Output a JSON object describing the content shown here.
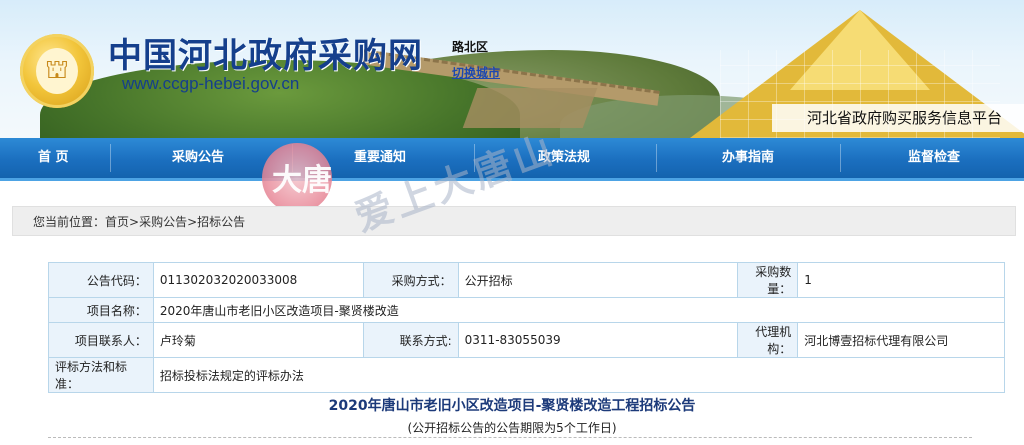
{
  "header": {
    "site_name": "中国河北政府采购网",
    "site_url": "www.ccgp-hebei.gov.cn",
    "region": "路北区",
    "switch_city": "切换城市",
    "platform": "河北省政府购买服务信息平台"
  },
  "nav": {
    "items": [
      {
        "label": "首 页"
      },
      {
        "label": "采购公告"
      },
      {
        "label": "重要通知"
      },
      {
        "label": "政策法规"
      },
      {
        "label": "办事指南"
      },
      {
        "label": "监督检查"
      }
    ]
  },
  "watermark": {
    "badge": "大唐",
    "text": "爱上大唐山"
  },
  "breadcrumb": {
    "prefix": "您当前位置：",
    "home": "首页",
    "sep1": ">",
    "level1": "采购公告",
    "sep2": ">",
    "level2": "招标公告"
  },
  "info": {
    "code_label": "公告代码：",
    "code_value": "011302032020033008",
    "method_label": "采购方式：",
    "method_value": "公开招标",
    "qty_label": "采购数量：",
    "qty_value": "1",
    "project_label": "项目名称：",
    "project_value": "2020年唐山市老旧小区改造项目-聚贤楼改造",
    "contact_label": "项目联系人：",
    "contact_value": "卢玲菊",
    "phone_label": "联系方式:",
    "phone_value": "0311-83055039",
    "agent_label": "代理机构：",
    "agent_value": "河北博壹招标代理有限公司",
    "eval_label": "评标方法和标准：",
    "eval_value": "招标投标法规定的评标办法"
  },
  "notice": {
    "title": "2020年唐山市老旧小区改造项目-聚贤楼改造工程招标公告",
    "subtitle": "(公开招标公告的公告期限为5个工作日)"
  }
}
